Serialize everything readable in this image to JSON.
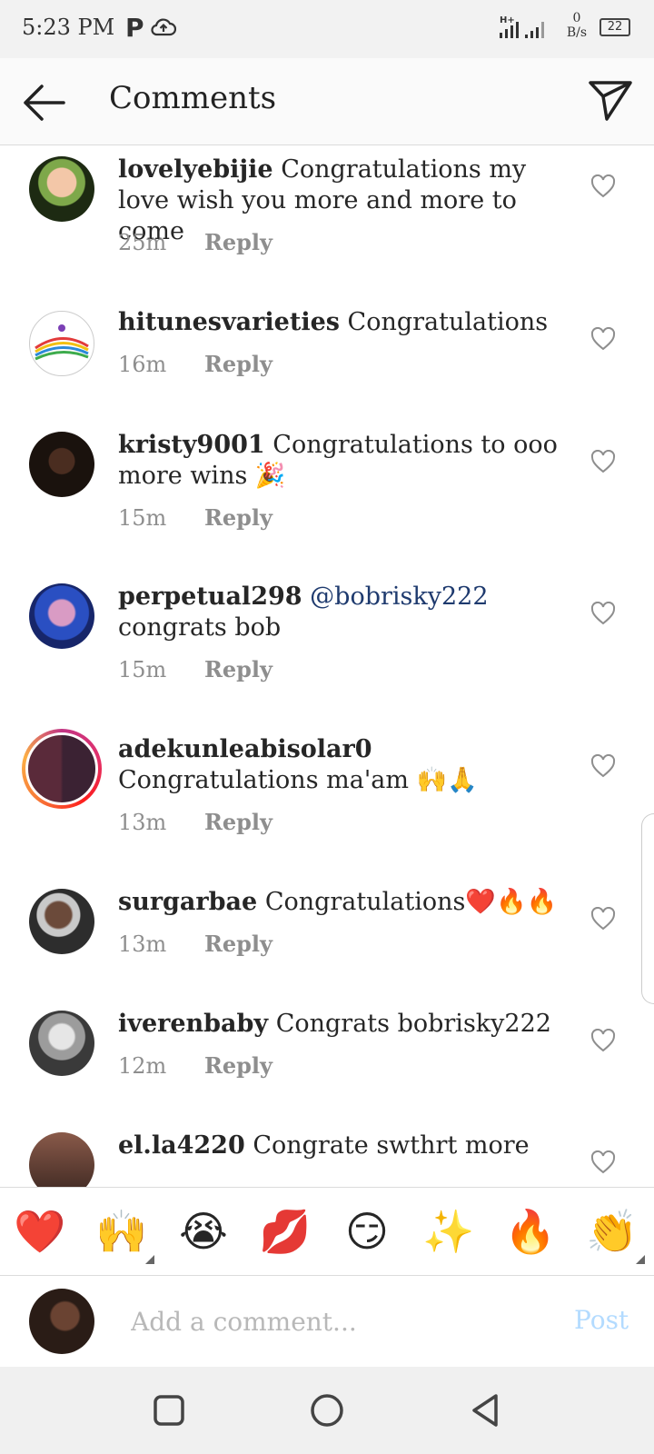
{
  "status_bar": {
    "time": "5:23 PM",
    "p_icon": "P",
    "net_speed_value": "0",
    "net_speed_unit": "B/s",
    "battery": "22"
  },
  "header": {
    "title": "Comments"
  },
  "comments": [
    {
      "user": "lovelyebijie",
      "text": "Congratulations my love wish you more and more to come",
      "time": "25m",
      "reply": "Reply",
      "mention": ""
    },
    {
      "user": "hitunesvarieties",
      "text": "Congratulations",
      "time": "16m",
      "reply": "Reply",
      "mention": ""
    },
    {
      "user": "kristy9001",
      "text": "Congratulations to ooo more wins 🎉",
      "time": "15m",
      "reply": "Reply",
      "mention": ""
    },
    {
      "user": "perpetual298",
      "mention": "@bobrisky222",
      "text": "congrats bob",
      "time": "15m",
      "reply": "Reply"
    },
    {
      "user": "adekunleabisolar0",
      "text": "Congratulations ma'am 🙌🙏",
      "time": "13m",
      "reply": "Reply",
      "mention": ""
    },
    {
      "user": "surgarbae",
      "text": "Congratulations❤️🔥🔥",
      "time": "13m",
      "reply": "Reply",
      "mention": ""
    },
    {
      "user": "iverenbaby",
      "text": "Congrats bobrisky222",
      "time": "12m",
      "reply": "Reply",
      "mention": ""
    },
    {
      "user": "el.la4220",
      "text": "Congrate swthrt more",
      "time": "",
      "reply": "",
      "mention": ""
    }
  ],
  "emoji_bar": [
    "❤️",
    "🙌",
    "😭",
    "💋",
    "😏",
    "✨",
    "🔥",
    "👏"
  ],
  "comment_box": {
    "placeholder": "Add a comment...",
    "post_label": "Post"
  },
  "colors": {
    "accent_blue_disabled": "#b3dbff",
    "mention": "#1e3a6e",
    "meta_gray": "#8e8e8e"
  }
}
